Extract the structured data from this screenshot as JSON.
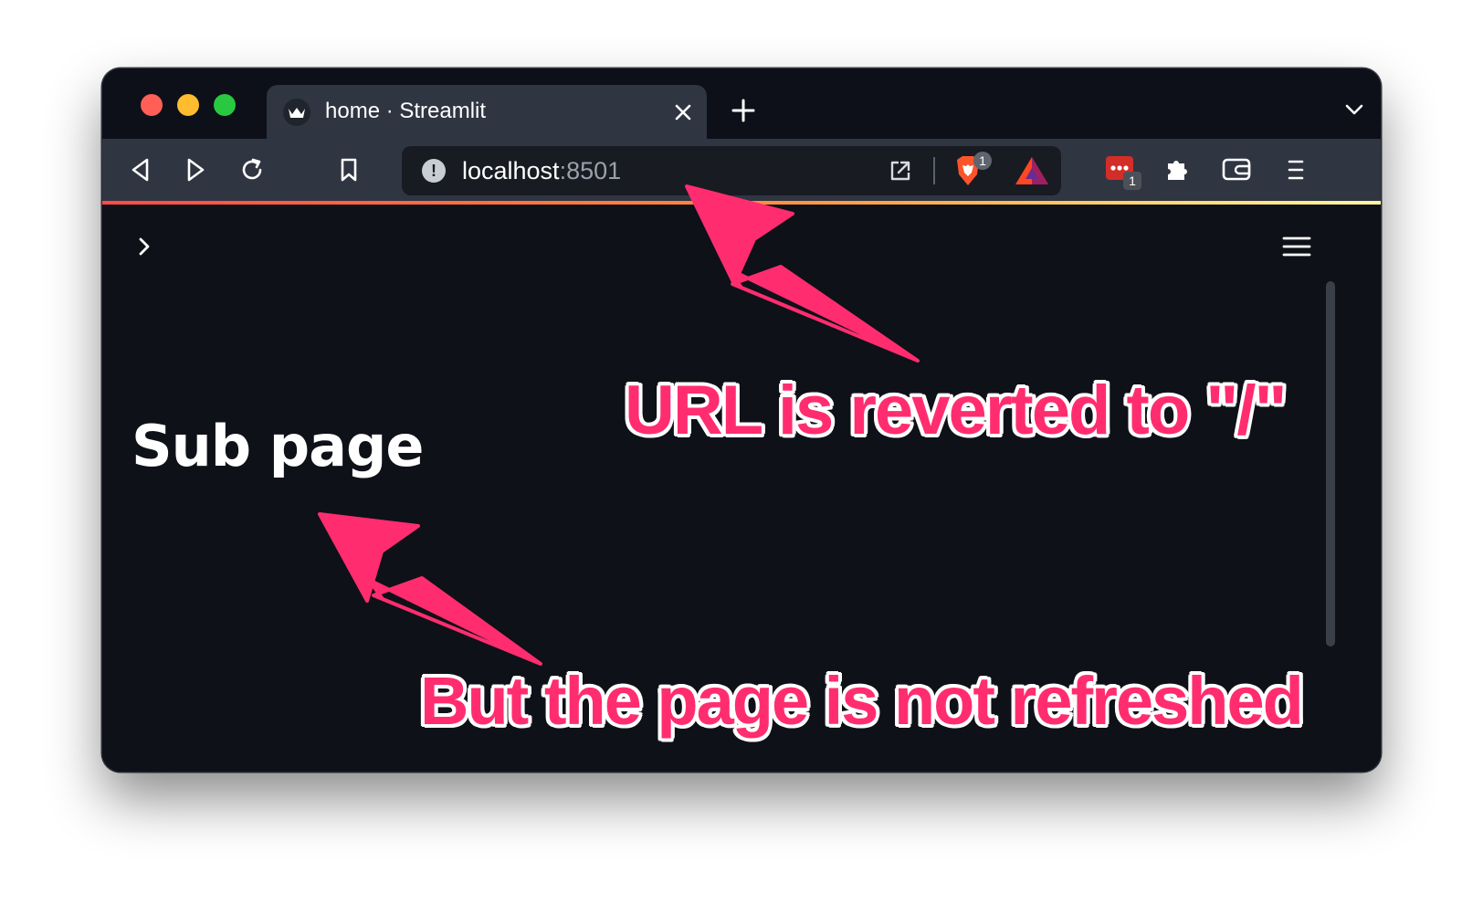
{
  "browser": {
    "tab": {
      "title": "home · Streamlit",
      "favicon": "streamlit-crown-icon"
    },
    "toolbar": {
      "back_icon": "back-arrow-icon",
      "forward_icon": "forward-arrow-icon",
      "reload_icon": "reload-icon",
      "bookmark_icon": "bookmark-icon",
      "url": {
        "host": "localhost",
        "port": ":8501"
      },
      "brave_shields_count": "1",
      "extension_badge_count": "1"
    },
    "colors": {
      "tab_active": "#303542",
      "tab_strip": "#0d1018",
      "content_bg": "#0e1117",
      "accent": "#ff4b4b"
    }
  },
  "app": {
    "heading": "Sub page",
    "sidebar_toggle_icon": "chevron-right-icon",
    "menu_icon": "hamburger-menu-icon"
  },
  "annotations": {
    "url_note": "URL is reverted to \"/\"",
    "page_note": "But the page is not refreshed",
    "color": "#ff2d6f"
  }
}
